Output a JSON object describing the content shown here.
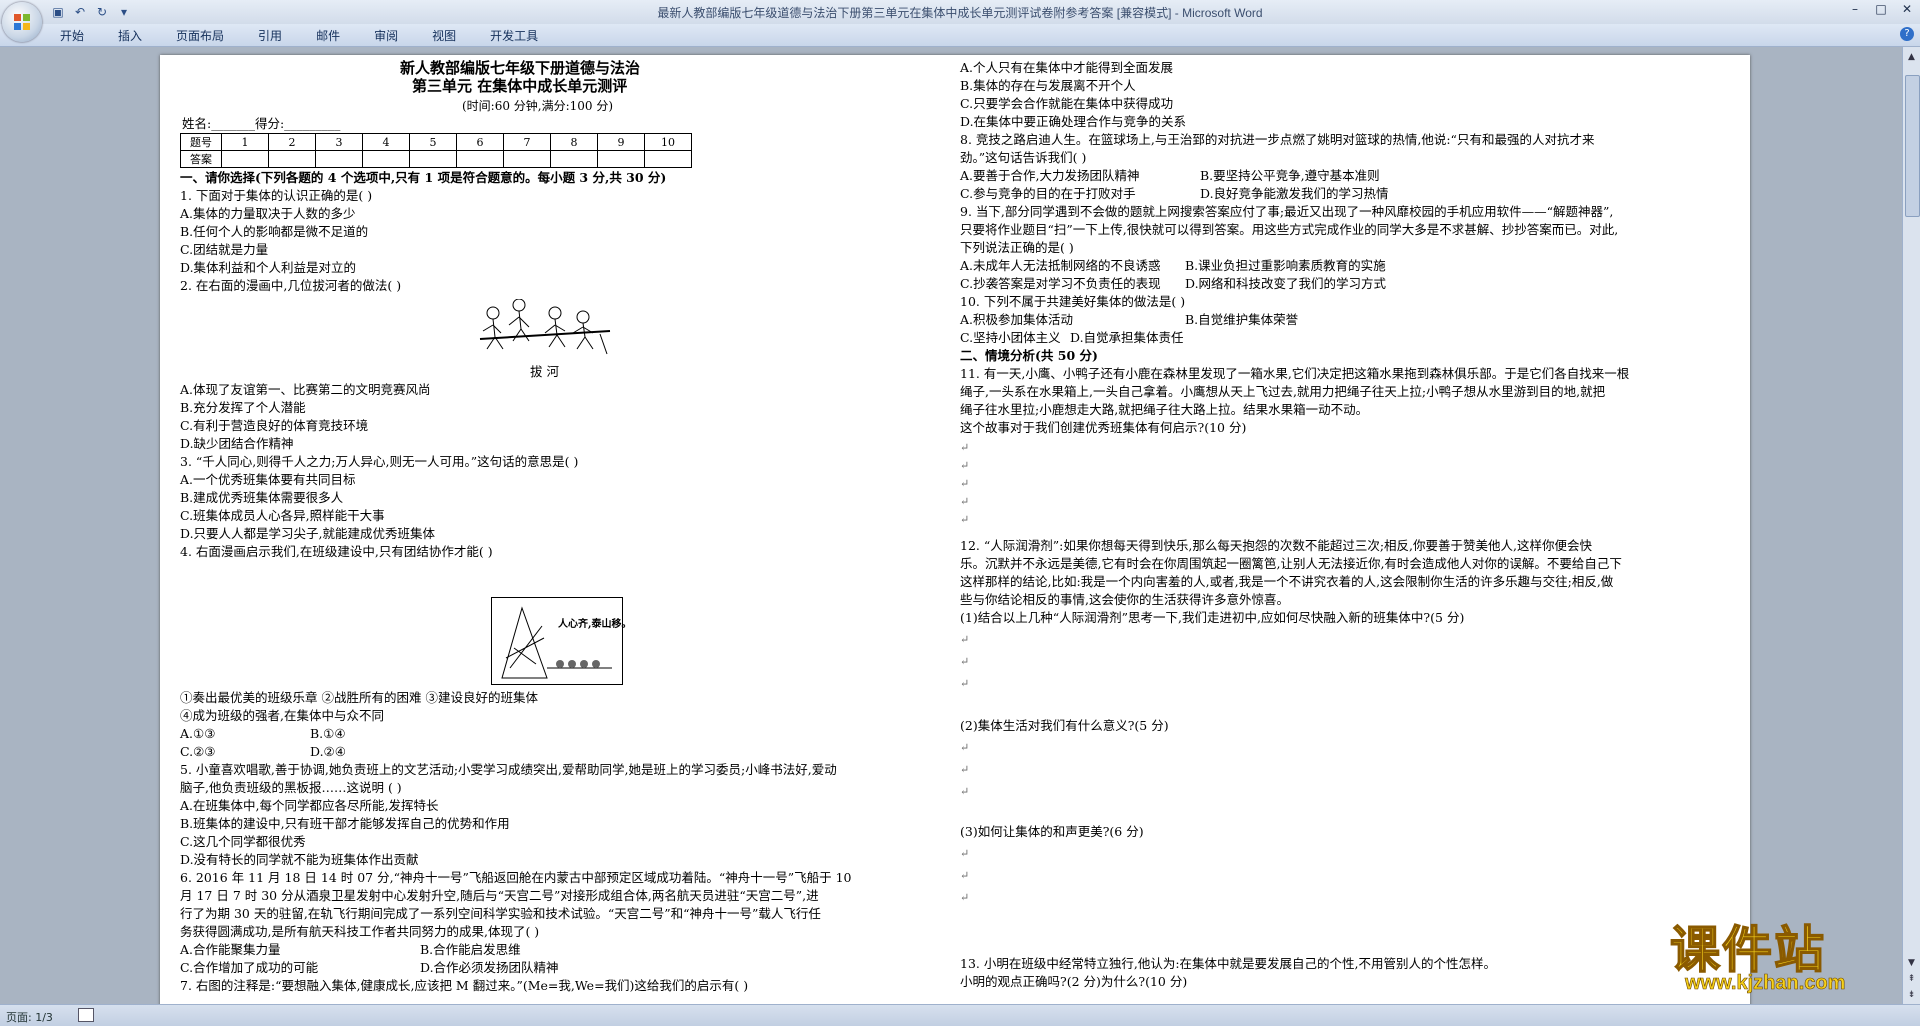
{
  "window": {
    "title": "最新人教部编版七年级道德与法治下册第三单元在集体中成长单元测评试卷附参考答案 [兼容模式] - Microsoft Word"
  },
  "ribbon": {
    "tabs": [
      "开始",
      "插入",
      "页面布局",
      "引用",
      "邮件",
      "审阅",
      "视图",
      "开发工具"
    ]
  },
  "status": {
    "page": "页面: 1/3"
  },
  "watermark": {
    "title": "课件站",
    "url": "www.kjzhan.com"
  },
  "doc": {
    "title1": "新人教部编版七年级下册道德与法治",
    "title2": "第三单元  在集体中成长单元测评",
    "subtitle": "(时间:60 分钟,满分:100 分)",
    "name_line": "姓名:_______得分:_________",
    "table_row1_label": "题号",
    "table_row2_label": "答案",
    "table_numbers": [
      "1",
      "2",
      "3",
      "4",
      "5",
      "6",
      "7",
      "8",
      "9",
      "10"
    ],
    "figure_caption": "拔  河",
    "figure2_text": "人心齐,泰山移。",
    "left": [
      "一、请你选择(下列各题的 4 个选项中,只有 1 项是符合题意的。每小题 3 分,共 30 分)",
      "1. 下面对于集体的认识正确的是(    )",
      "A.集体的力量取决于人数的多少",
      "B.任何个人的影响都是微不足道的",
      "C.团结就是力量",
      "D.集体利益和个人利益是对立的",
      "2. 在右面的漫画中,几位拔河者的做法(      )",
      "A.体现了友谊第一、比赛第二的文明竞赛风尚",
      "B.充分发挥了个人潜能",
      "C.有利于营造良好的体育竞技环境",
      "D.缺少团结合作精神",
      "3. “千人同心,则得千人之力;万人异心,则无一人可用。”这句话的意思是(      )",
      "A.一个优秀班集体要有共同目标",
      "B.建成优秀班集体需要很多人",
      "C.班集体成员人心各异,照样能干大事",
      "D.只要人人都是学习尖子,就能建成优秀班集体",
      "4. 右面漫画启示我们,在班级建设中,只有团结协作才能(      )",
      "①奏出最优美的班级乐章   ②战胜所有的困难   ③建设良好的班集体",
      "④成为班级的强者,在集体中与众不同",
      "A.①③",
      "B.①④",
      "C.②③",
      "D.②④",
      "5. 小童喜欢唱歌,善于协调,她负责班上的文艺活动;小雯学习成绩突出,爱帮助同学,她是班上的学习委员;小峰书法好,爱动",
      "脑子,他负责班级的黑板报……这说明                       (      )",
      "A.在班集体中,每个同学都应各尽所能,发挥特长",
      "B.班集体的建设中,只有班干部才能够发挥自己的优势和作用",
      "C.这几个同学都很优秀",
      "D.没有特长的同学就不能为班集体作出贡献",
      "6. 2016 年 11 月 18 日 14 时 07 分,“神舟十一号”飞船返回舱在内蒙古中部预定区域成功着陆。“神舟十一号”飞船于 10",
      "月 17 日 7 时 30 分从酒泉卫星发射中心发射升空,随后与“天宫二号”对接形成组合体,两名航天员进驻“天宫二号”,进",
      "行了为期 30 天的驻留,在轨飞行期间完成了一系列空间科学实验和技术试验。“天宫二号”和“神舟十一号”载人飞行任",
      "务获得圆满成功,是所有航天科技工作者共同努力的成果,体现了(      )",
      "A.合作能聚集力量",
      "B.合作能启发思维",
      "C.合作增加了成功的可能",
      "D.合作必须发扬团队精神",
      "7. 右图的注释是:“要想融入集体,健康成长,应该把 M 翻过来。”(Me=我,We=我们)这给我们的启示有(      )"
    ],
    "right": [
      "A.个人只有在集体中才能得到全面发展",
      "B.集体的存在与发展离不开个人",
      "C.只要学会合作就能在集体中获得成功",
      "D.在集体中要正确处理合作与竞争的关系",
      "8. 竞技之路启迪人生。在篮球场上,与王治郅的对抗进一步点燃了姚明对篮球的热情,他说:“只有和最强的人对抗才来",
      "劲。”这句话告诉我们(      )",
      "A.要善于合作,大力发扬团队精神",
      "B.要坚持公平竞争,遵守基本准则",
      "C.参与竞争的目的在于打败对手",
      "D.良好竞争能激发我们的学习热情",
      "9. 当下,部分同学遇到不会做的题就上网搜索答案应付了事;最近又出现了一种风靡校园的手机应用软件——“解题神器”,",
      "只要将作业题目“扫”一下上传,很快就可以得到答案。用这些方式完成作业的同学大多是不求甚解、抄抄答案而已。对此,",
      "下列说法正确的是(      )",
      "A.未成年人无法抵制网络的不良诱惑",
      "B.课业负担过重影响素质教育的实施",
      "C.抄袭答案是对学习不负责任的表现",
      "D.网络和科技改变了我们的学习方式",
      "10. 下列不属于共建美好集体的做法是(      )",
      "A.积极参加集体活动",
      "B.自觉维护集体荣誉",
      "C.坚持小团体主义",
      "D.自觉承担集体责任",
      "二、情境分析(共 50 分)",
      "11. 有一天,小鹰、小鸭子还有小鹿在森林里发现了一箱水果,它们决定把这箱水果拖到森林俱乐部。于是它们各自找来一根",
      "绳子,一头系在水果箱上,一头自己拿着。小鹰想从天上飞过去,就用力把绳子往天上拉;小鸭子想从水里游到目的地,就把",
      "绳子往水里拉;小鹿想走大路,就把绳子往大路上拉。结果水果箱一动不动。",
      "这个故事对于我们创建优秀班集体有何启示?(10 分)",
      "12. “人际润滑剂”:如果你想每天得到快乐,那么每天抱怨的次数不能超过三次;相反,你要善于赞美他人,这样你便会快",
      "乐。沉默并不永远是美德,它有时会在你周围筑起一圈篱笆,让别人无法接近你,有时会造成他人对你的误解。不要给自己下",
      "这样那样的结论,比如:我是一个内向害羞的人,或者,我是一个不讲究衣着的人,这会限制你生活的许多乐趣与交往;相反,做",
      "些与你结论相反的事情,这会使你的生活获得许多意外惊喜。",
      "(1)结合以上几种“人际润滑剂”思考一下,我们走进初中,应如何尽快融入新的班集体中?(5 分)",
      "(2)集体生活对我们有什么意义?(5 分)",
      "(3)如何让集体的和声更美?(6 分)",
      "13. 小明在班级中经常特立独行,他认为:在集体中就是要发展自己的个性,不用管别人的个性怎样。",
      "小明的观点正确吗?(2 分)为什么?(10 分)"
    ]
  }
}
